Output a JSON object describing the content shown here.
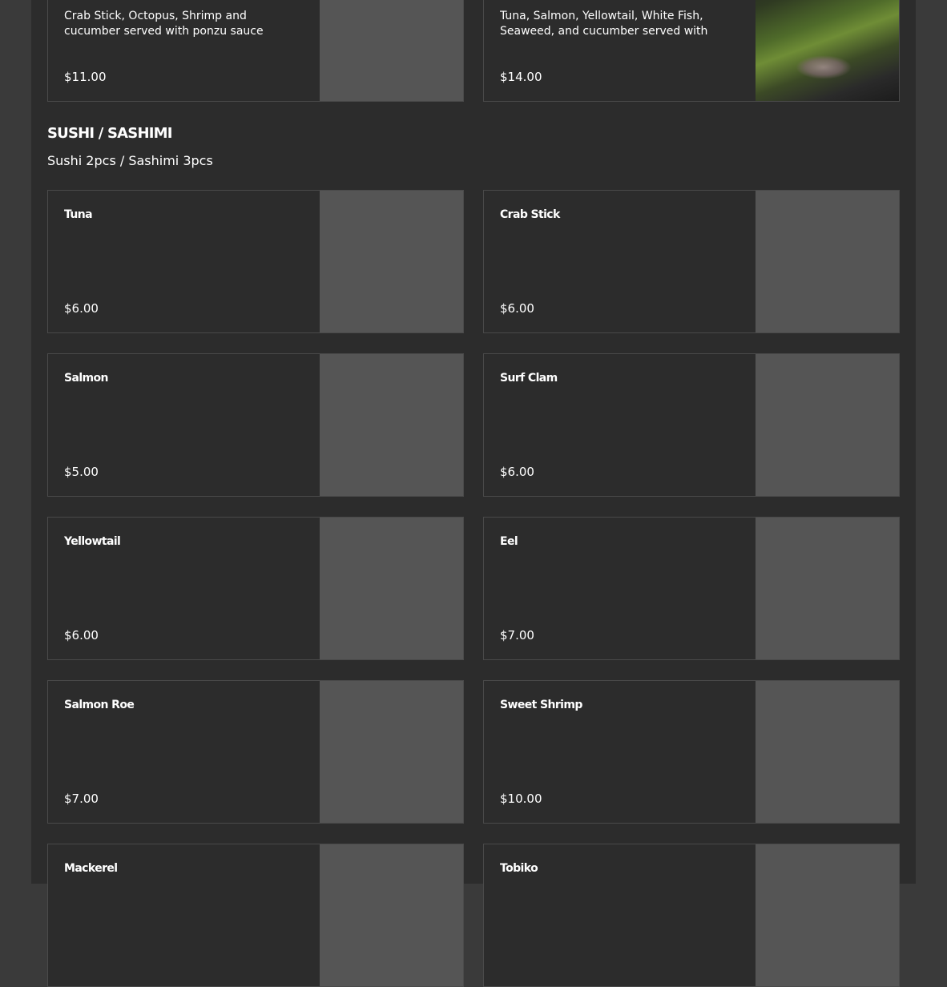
{
  "top_items": [
    {
      "description": "Crab Stick, Octopus, Shrimp and cucumber served with ponzu sauce",
      "price": "$11.00",
      "has_image": false
    },
    {
      "description": "Tuna, Salmon, Yellowtail, White Fish, Seaweed, and cucumber served with chef'…",
      "price": "$14.00",
      "has_image": true
    }
  ],
  "section": {
    "title": "SUSHI / SASHIMI",
    "subtitle": "Sushi 2pcs / Sashimi 3pcs"
  },
  "items": [
    {
      "name": "Tuna",
      "price": "$6.00"
    },
    {
      "name": "Crab Stick",
      "price": "$6.00"
    },
    {
      "name": "Salmon",
      "price": "$5.00"
    },
    {
      "name": "Surf Clam",
      "price": "$6.00"
    },
    {
      "name": "Yellowtail",
      "price": "$6.00"
    },
    {
      "name": "Eel",
      "price": "$7.00"
    },
    {
      "name": "Salmon Roe",
      "price": "$7.00"
    },
    {
      "name": "Sweet Shrimp",
      "price": "$10.00"
    },
    {
      "name": "Mackerel",
      "price": ""
    },
    {
      "name": "Tobiko",
      "price": ""
    }
  ],
  "colors": {
    "page_background": "#2c2c2c",
    "outer_background": "#3a3a3a",
    "card_border": "#4a4a4a",
    "image_placeholder": "#555555",
    "text": "#ffffff"
  }
}
